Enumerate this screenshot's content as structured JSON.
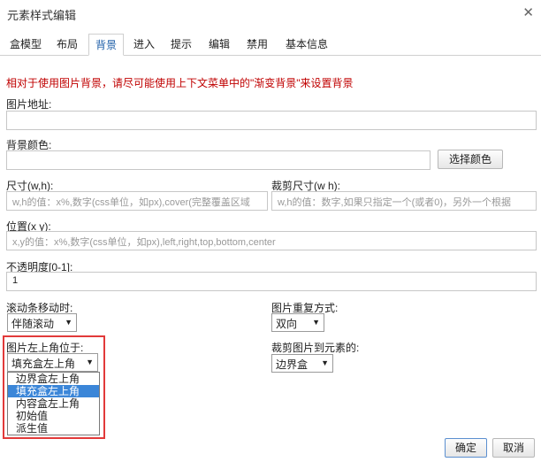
{
  "dialog": {
    "title": "元素样式编辑"
  },
  "tabs": [
    {
      "label": "盒模型"
    },
    {
      "label": "布局"
    },
    {
      "label": "背景"
    },
    {
      "label": "进入"
    },
    {
      "label": "提示"
    },
    {
      "label": "编辑"
    },
    {
      "label": "禁用"
    },
    {
      "label": "基本信息"
    }
  ],
  "hint": "相对于使用图片背景，请尽可能使用上下文菜单中的\"渐变背景\"来设置背景",
  "image_url": {
    "label": "图片地址:",
    "value": ""
  },
  "bg_color": {
    "label": "背景颜色:",
    "value": "",
    "button": "选择颜色"
  },
  "size": {
    "label": "尺寸(w,h):",
    "placeholder": "w,h的值：x%,数字(css单位，如px),cover(完整覆盖区域"
  },
  "crop_size": {
    "label": "裁剪尺寸(w h):",
    "placeholder": "w,h的值：数字,如果只指定一个(或者0)，另外一个根据"
  },
  "position": {
    "label": "位置(x y):",
    "placeholder": "x,y的值：x%,数字(css单位，如px),left,right,top,bottom,center"
  },
  "opacity": {
    "label": "不透明度[0-1]:",
    "value": "1"
  },
  "scroll": {
    "label": "滚动条移动时:",
    "value": "伴随滚动"
  },
  "repeat": {
    "label": "图片重复方式:",
    "value": "双向"
  },
  "origin": {
    "label": "图片左上角位于:",
    "value": "填充盒左上角",
    "options": [
      "边界盒左上角",
      "填充盒左上角",
      "内容盒左上角",
      "初始值",
      "派生值"
    ],
    "highlighted_index": 1
  },
  "clip": {
    "label": "裁剪图片到元素的:",
    "value": "边界盒"
  },
  "footer": {
    "ok": "确定",
    "cancel": "取消"
  },
  "colors": {
    "accent": "#3b86d8",
    "hint": "#c00000",
    "highlight": "#e23a3a"
  }
}
